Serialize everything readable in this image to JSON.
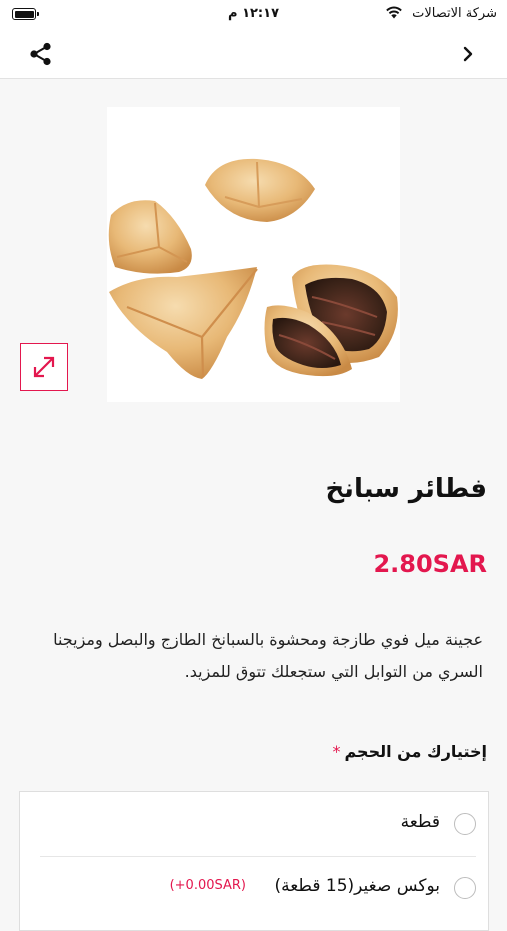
{
  "status_bar": {
    "carrier": "شركة الاتصالات",
    "time": "١٢:١٧ م"
  },
  "nav": {
    "share_icon": "share-icon",
    "back_icon": "chevron-right-icon"
  },
  "product": {
    "title": "فطائر سبانخ",
    "price": "2.80SAR",
    "description": "عجينة ميل فوي طازجة ومحشوة بالسبانخ الطازج والبصل ومزيجنا السري من التوابل التي ستجعلك تتوق للمزيد.",
    "expand_icon": "expand-icon"
  },
  "options": {
    "heading": "إختيارك من الحجم",
    "required_mark": "*",
    "items": [
      {
        "label": "قطعة",
        "extra": ""
      },
      {
        "label": "بوكس صغير(15 قطعة)",
        "extra": "(+0.00SAR)"
      }
    ]
  },
  "colors": {
    "accent": "#e3174e",
    "background": "#f7f7f7"
  }
}
